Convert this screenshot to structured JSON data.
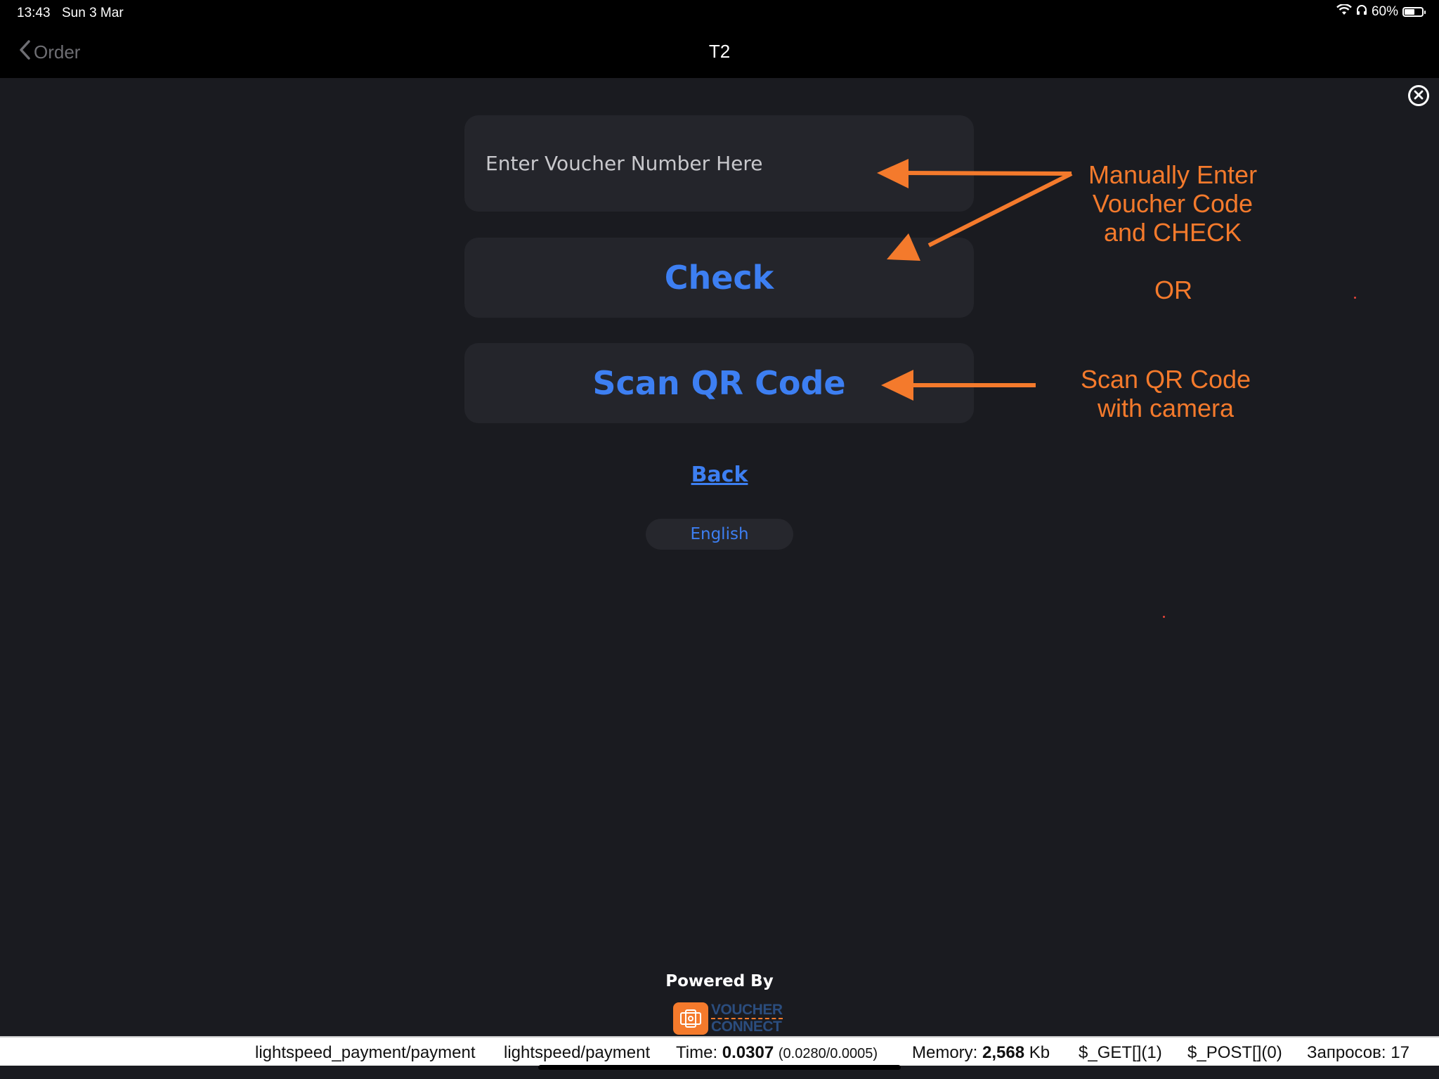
{
  "status_bar": {
    "time": "13:43",
    "date": "Sun 3 Mar",
    "battery": "60%",
    "battery_level": 0.6
  },
  "nav": {
    "back_label": "Order",
    "title": "T2"
  },
  "voucher": {
    "placeholder": "Enter Voucher Number Here",
    "check_label": "Check",
    "scan_label": "Scan QR Code",
    "back_link": "Back",
    "language": "English"
  },
  "annotations": {
    "manual_line1": "Manually Enter",
    "manual_line2": "Voucher Code",
    "manual_line3": "and CHECK",
    "or": "OR",
    "scan_line1": "Scan QR Code",
    "scan_line2": "with camera"
  },
  "footer": {
    "powered_by": "Powered By",
    "logo_line1": "VOUCHER",
    "logo_line2": "CONNECT"
  },
  "debug": {
    "route1": "lightspeed_payment/payment",
    "route2": "lightspeed/payment",
    "time_label": "Time:",
    "time_value": "0.0307",
    "time_detail": "(0.0280/0.0005)",
    "memory_label": "Memory:",
    "memory_value": "2,568",
    "memory_unit": "Kb",
    "get": "$_GET[](1)",
    "post": "$_POST[](0)",
    "requests": "Запросов: 17"
  },
  "colors": {
    "accent": "#3d7ff2",
    "annotation": "#f47a2c",
    "background": "#1a1b20",
    "card": "#24252b"
  }
}
